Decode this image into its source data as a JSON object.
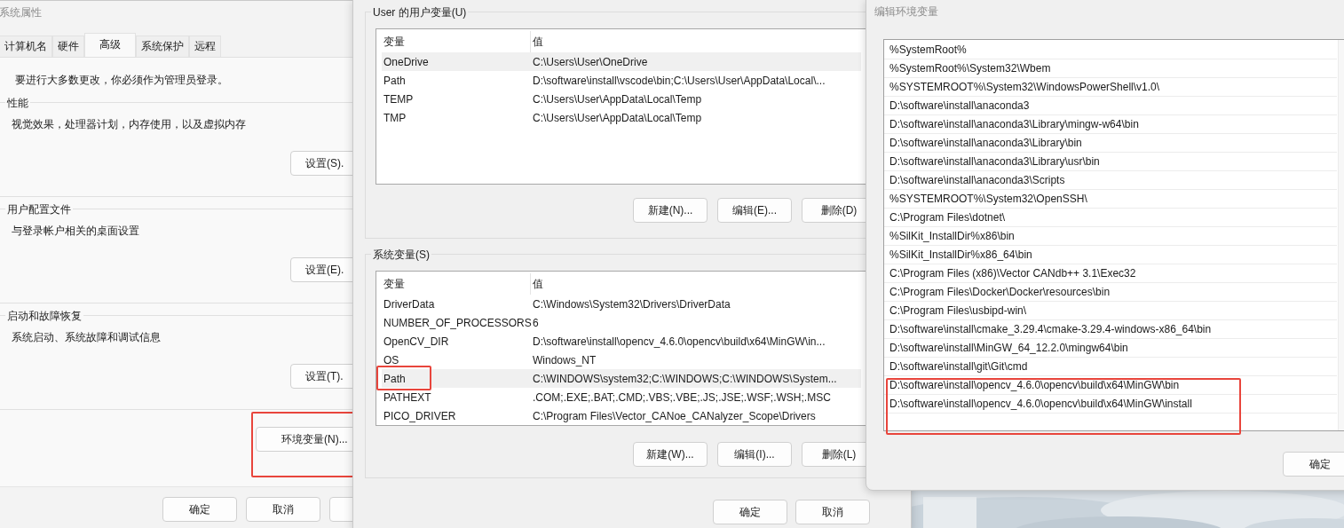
{
  "system_properties": {
    "title": "系统属性",
    "tabs": [
      {
        "label": "计算机名",
        "selected": false
      },
      {
        "label": "硬件",
        "selected": false
      },
      {
        "label": "高级",
        "selected": true
      },
      {
        "label": "系统保护",
        "selected": false
      },
      {
        "label": "远程",
        "selected": false
      }
    ],
    "admin_note": "要进行大多数更改，你必须作为管理员登录。",
    "groups": [
      {
        "title": "性能",
        "description": "视觉效果，处理器计划，内存使用，以及虚拟内存",
        "button": "设置(S)."
      },
      {
        "title": "用户配置文件",
        "description": "与登录帐户相关的桌面设置",
        "button": "设置(E)."
      },
      {
        "title": "启动和故障恢复",
        "description": "系统启动、系统故障和调试信息",
        "button": "设置(T)."
      }
    ],
    "env_button": {
      "label": "环境变量(N)...",
      "highlighted": true
    },
    "footer_buttons": [
      "确定",
      "取消"
    ]
  },
  "environment_variables": {
    "user_group": {
      "title": "User 的用户变量(U)",
      "columns": [
        "变量",
        "值"
      ],
      "rows": [
        {
          "name": "OneDrive",
          "value": "C:\\Users\\User\\OneDrive",
          "selected": true,
          "highlighted": false
        },
        {
          "name": "Path",
          "value": "D:\\software\\install\\vscode\\bin;C:\\Users\\User\\AppData\\Local\\...",
          "selected": false,
          "highlighted": false
        },
        {
          "name": "TEMP",
          "value": "C:\\Users\\User\\AppData\\Local\\Temp",
          "selected": false,
          "highlighted": false
        },
        {
          "name": "TMP",
          "value": "C:\\Users\\User\\AppData\\Local\\Temp",
          "selected": false,
          "highlighted": false
        }
      ],
      "buttons": [
        "新建(N)...",
        "编辑(E)...",
        "删除(D)"
      ]
    },
    "system_group": {
      "title": "系统变量(S)",
      "columns": [
        "变量",
        "值"
      ],
      "rows": [
        {
          "name": "DriverData",
          "value": "C:\\Windows\\System32\\Drivers\\DriverData",
          "selected": false,
          "highlighted": false
        },
        {
          "name": "NUMBER_OF_PROCESSORS",
          "value": "6",
          "selected": false,
          "highlighted": false
        },
        {
          "name": "OpenCV_DIR",
          "value": "D:\\software\\install\\opencv_4.6.0\\opencv\\build\\x64\\MinGW\\in...",
          "selected": false,
          "highlighted": false
        },
        {
          "name": "OS",
          "value": "Windows_NT",
          "selected": false,
          "highlighted": false
        },
        {
          "name": "Path",
          "value": "C:\\WINDOWS\\system32;C:\\WINDOWS;C:\\WINDOWS\\System...",
          "selected": true,
          "highlighted": true
        },
        {
          "name": "PATHEXT",
          "value": ".COM;.EXE;.BAT;.CMD;.VBS;.VBE;.JS;.JSE;.WSF;.WSH;.MSC",
          "selected": false,
          "highlighted": false
        },
        {
          "name": "PICO_DRIVER",
          "value": "C:\\Program Files\\Vector_CANoe_CANalyzer_Scope\\Drivers",
          "selected": false,
          "highlighted": false
        }
      ],
      "buttons": [
        "新建(W)...",
        "编辑(I)...",
        "删除(L)"
      ]
    },
    "footer_buttons": [
      "确定",
      "取消"
    ]
  },
  "edit_variable": {
    "title": "编辑环境变量",
    "entries": [
      {
        "text": "%SystemRoot%",
        "highlighted": false
      },
      {
        "text": "%SystemRoot%\\System32\\Wbem",
        "highlighted": false
      },
      {
        "text": "%SYSTEMROOT%\\System32\\WindowsPowerShell\\v1.0\\",
        "highlighted": false
      },
      {
        "text": "D:\\software\\install\\anaconda3",
        "highlighted": false
      },
      {
        "text": "D:\\software\\install\\anaconda3\\Library\\mingw-w64\\bin",
        "highlighted": false
      },
      {
        "text": "D:\\software\\install\\anaconda3\\Library\\bin",
        "highlighted": false
      },
      {
        "text": "D:\\software\\install\\anaconda3\\Library\\usr\\bin",
        "highlighted": false
      },
      {
        "text": "D:\\software\\install\\anaconda3\\Scripts",
        "highlighted": false
      },
      {
        "text": "%SYSTEMROOT%\\System32\\OpenSSH\\",
        "highlighted": false
      },
      {
        "text": "C:\\Program Files\\dotnet\\",
        "highlighted": false
      },
      {
        "text": "%SilKit_InstallDir%x86\\bin",
        "highlighted": false
      },
      {
        "text": "%SilKit_InstallDir%x86_64\\bin",
        "highlighted": false
      },
      {
        "text": "C:\\Program Files (x86)\\Vector CANdb++ 3.1\\Exec32",
        "highlighted": false
      },
      {
        "text": "C:\\Program Files\\Docker\\Docker\\resources\\bin",
        "highlighted": false
      },
      {
        "text": "C:\\Program Files\\usbipd-win\\",
        "highlighted": false
      },
      {
        "text": "D:\\software\\install\\cmake_3.29.4\\cmake-3.29.4-windows-x86_64\\bin",
        "highlighted": false
      },
      {
        "text": "D:\\software\\install\\MinGW_64_12.2.0\\mingw64\\bin",
        "highlighted": false
      },
      {
        "text": "D:\\software\\install\\git\\Git\\cmd",
        "highlighted": false
      },
      {
        "text": "D:\\software\\install\\opencv_4.6.0\\opencv\\build\\x64\\MinGW\\bin",
        "highlighted": true
      },
      {
        "text": "D:\\software\\install\\opencv_4.6.0\\opencv\\build\\x64\\MinGW\\install",
        "highlighted": true
      }
    ],
    "buttons": [
      "确定"
    ]
  }
}
